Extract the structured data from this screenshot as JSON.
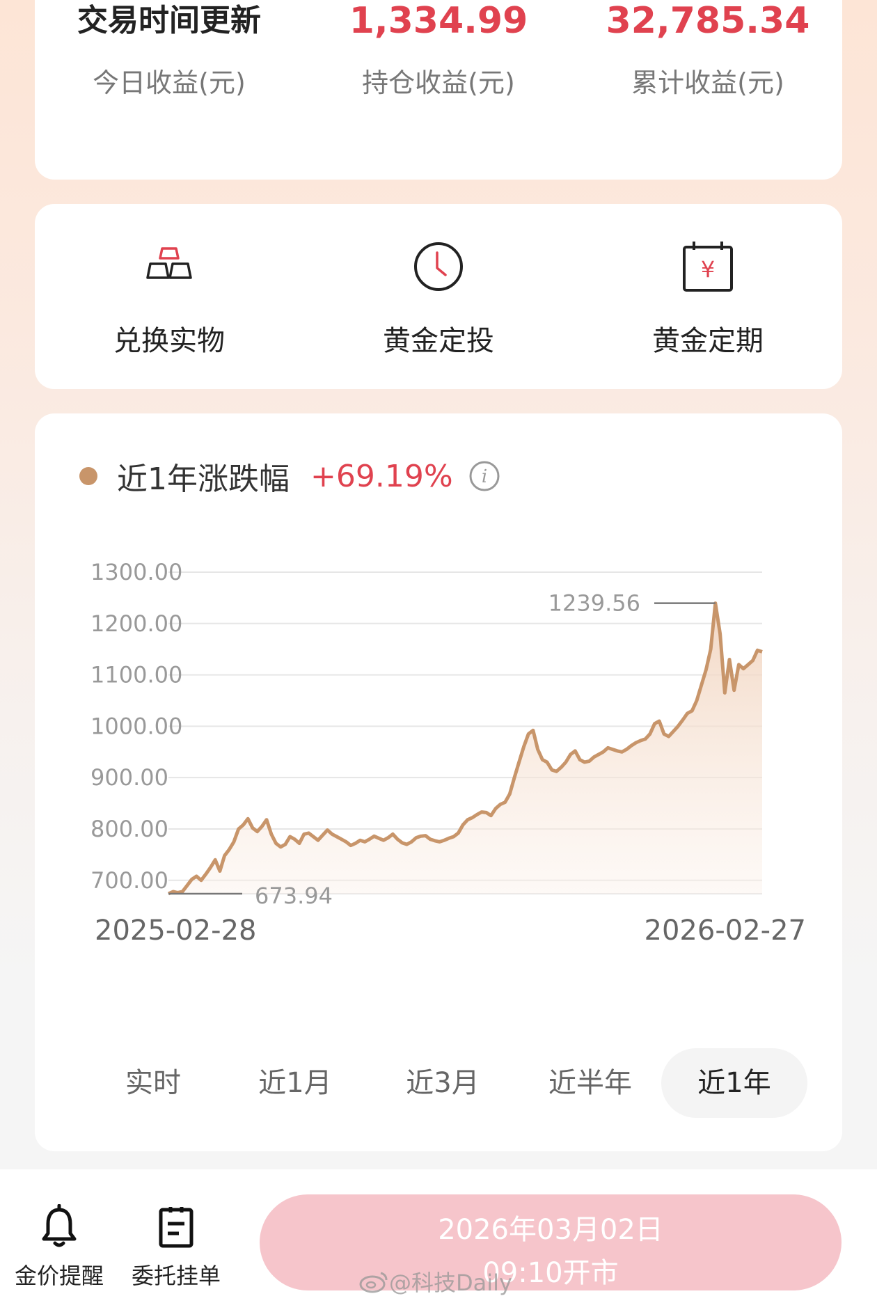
{
  "summary": {
    "items": [
      {
        "value": "交易时间更新",
        "label": "今日收益(元)"
      },
      {
        "value": "1,334.99",
        "label": "持仓收益(元)"
      },
      {
        "value": "32,785.34",
        "label": "累计收益(元)"
      }
    ]
  },
  "actions": [
    {
      "label": "兑换实物",
      "icon": "gold-bars-icon"
    },
    {
      "label": "黄金定投",
      "icon": "clock-icon"
    },
    {
      "label": "黄金定期",
      "icon": "calendar-yen-icon"
    }
  ],
  "chart_header": {
    "title": "近1年涨跌幅",
    "change": "+69.19%"
  },
  "chart_data": {
    "type": "area",
    "title": "",
    "ylim": [
      673.94,
      1300
    ],
    "y_ticks": [
      "1300.00",
      "1200.00",
      "1100.00",
      "1000.00",
      "900.00",
      "800.00",
      "700.00"
    ],
    "y_tick_values": [
      1300,
      1200,
      1100,
      1000,
      900,
      800,
      700
    ],
    "x_start_label": "2025-02-28",
    "x_end_label": "2026-02-27",
    "max_label": "1239.56",
    "min_label": "673.94",
    "line_color": "#c8956a",
    "series": [
      {
        "values": [
          673.94,
          678,
          676,
          678,
          690,
          702,
          708,
          700,
          712,
          725,
          740,
          718,
          748,
          760,
          775,
          800,
          808,
          820,
          802,
          795,
          805,
          818,
          790,
          772,
          765,
          770,
          785,
          780,
          772,
          790,
          792,
          785,
          778,
          788,
          798,
          790,
          785,
          780,
          775,
          768,
          772,
          778,
          775,
          780,
          786,
          782,
          778,
          783,
          790,
          780,
          773,
          770,
          775,
          783,
          786,
          787,
          780,
          777,
          775,
          778,
          782,
          785,
          792,
          808,
          818,
          822,
          828,
          833,
          832,
          826,
          840,
          848,
          852,
          868,
          900,
          930,
          960,
          985,
          992,
          955,
          935,
          930,
          915,
          912,
          920,
          930,
          945,
          952,
          935,
          930,
          932,
          940,
          945,
          950,
          958,
          955,
          952,
          950,
          955,
          962,
          968,
          972,
          975,
          985,
          1005,
          1010,
          985,
          980,
          990,
          1000,
          1012,
          1025,
          1030,
          1050,
          1080,
          1110,
          1150,
          1239.56,
          1180,
          1065,
          1130,
          1070,
          1120,
          1112,
          1120,
          1128,
          1148,
          1145
        ]
      }
    ]
  },
  "period_tabs": [
    {
      "label": "实时",
      "active": false
    },
    {
      "label": "近1月",
      "active": false
    },
    {
      "label": "近3月",
      "active": false
    },
    {
      "label": "近半年",
      "active": false
    },
    {
      "label": "近1年",
      "active": true
    }
  ],
  "bottom_bar": {
    "price_alert": "金价提醒",
    "orders": "委托挂单",
    "open_date": "2026年03月02日",
    "open_time": "09:10开市"
  },
  "watermark": "@科技Daily",
  "colors": {
    "accent_red": "#e0424f",
    "gold": "#c8956a",
    "button_pink": "#f6c5cb"
  }
}
